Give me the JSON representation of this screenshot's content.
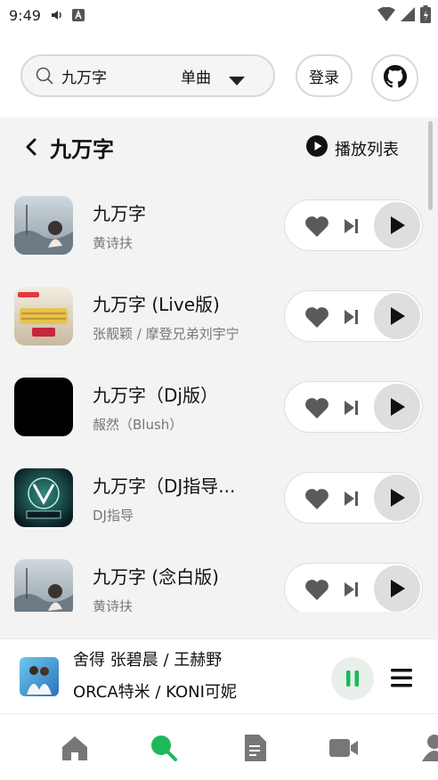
{
  "status_bar": {
    "time": "9:49"
  },
  "search": {
    "query": "九万字",
    "type": "单曲"
  },
  "header": {
    "login_label": "登录"
  },
  "panel": {
    "title": "九万字",
    "playlist_label": "播放列表"
  },
  "songs": [
    {
      "title": "九万字",
      "artist": "黄诗扶"
    },
    {
      "title": "九万字 (Live版)",
      "artist": "张靓颖 / 摩登兄弟刘宇宁"
    },
    {
      "title": "九万字（Dj版）",
      "artist": "赧然（Blush）"
    },
    {
      "title": "九万字（DJ指导...",
      "artist": "DJ指导"
    },
    {
      "title": "九万字 (念白版)",
      "artist": "黄诗扶"
    }
  ],
  "now_playing": {
    "title": "舍得 张碧晨 / 王赫野",
    "artist": "ORCA特米 / KONI可妮"
  },
  "nav": [
    {
      "icon": "home-icon"
    },
    {
      "icon": "search-icon"
    },
    {
      "icon": "document-icon"
    },
    {
      "icon": "video-icon"
    },
    {
      "icon": "user-icon"
    }
  ],
  "colors": {
    "accent": "#1db95a",
    "text": "#111111",
    "muted": "#777777"
  }
}
